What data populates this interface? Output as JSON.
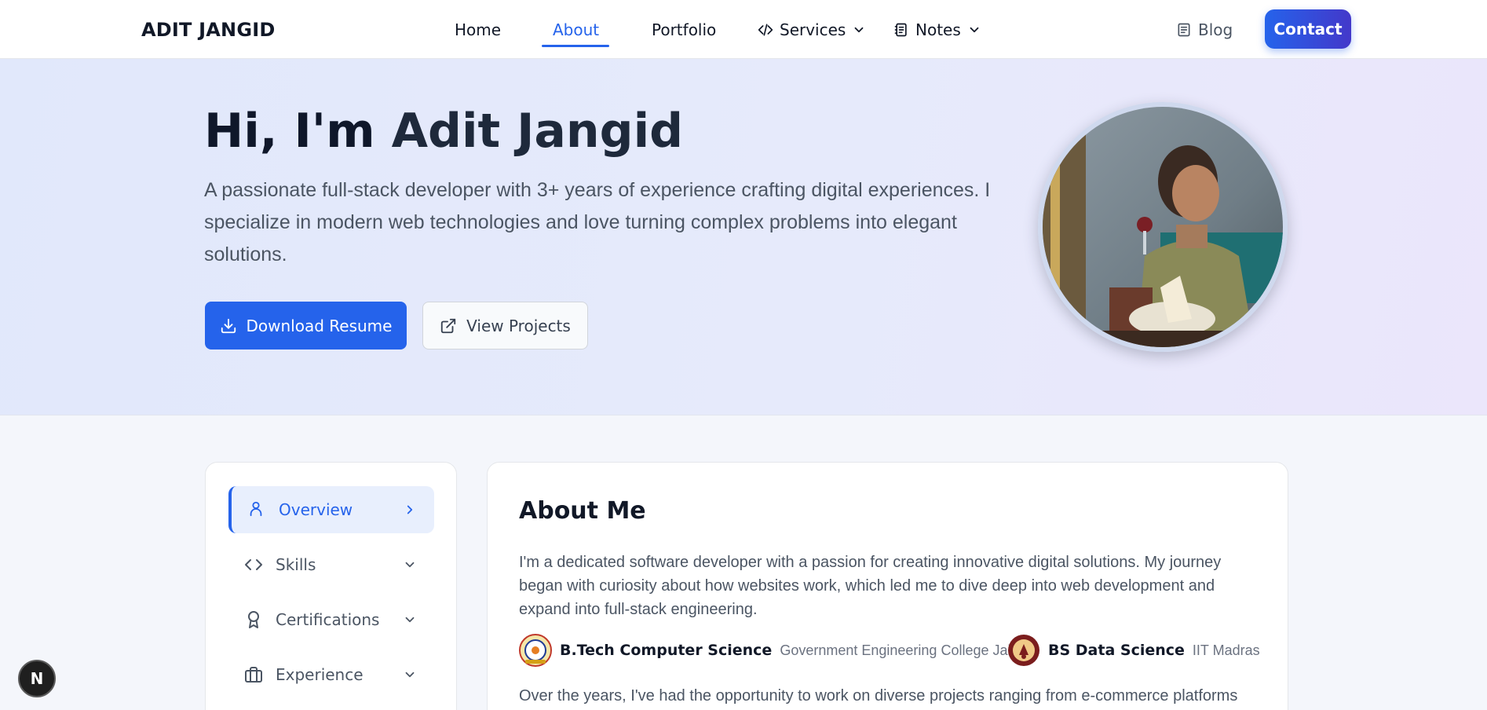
{
  "nav": {
    "brand": "ADIT JANGID",
    "home": "Home",
    "about": "About",
    "portfolio": "Portfolio",
    "services": "Services",
    "notes": "Notes",
    "blog": "Blog",
    "contact": "Contact",
    "active": "About"
  },
  "hero": {
    "greeting": "Hi, I'm",
    "name": "Adit Jangid",
    "description": "A passionate full-stack developer with 3+ years of experience crafting digital experiences. I specialize in modern web technologies and love turning complex problems into elegant solutions.",
    "download_resume": "Download Resume",
    "view_projects": "View Projects"
  },
  "sidebar": {
    "items": [
      {
        "label": "Overview",
        "icon": "user-icon",
        "active": true
      },
      {
        "label": "Skills",
        "icon": "code-icon",
        "active": false
      },
      {
        "label": "Certifications",
        "icon": "award-icon",
        "active": false
      },
      {
        "label": "Experience",
        "icon": "briefcase-icon",
        "active": false
      }
    ]
  },
  "about": {
    "title": "About Me",
    "paragraph1": "I'm a dedicated software developer with a passion for creating innovative digital solutions. My journey began with curiosity about how websites work, which led me to dive deep into web development and expand into full-stack engineering.",
    "education": [
      {
        "degree": "B.Tech Computer Science",
        "institution": "Government Engineering College Jaipur"
      },
      {
        "degree": "BS Data Science",
        "institution": "IIT Madras"
      }
    ],
    "paragraph2": "Over the years, I've had the opportunity to work on diverse projects ranging from e-commerce platforms"
  },
  "badge": {
    "letter": "N"
  },
  "colors": {
    "accent": "#2563eb",
    "contact_gradient_end": "#4338ca",
    "text_dark": "#111827",
    "text_muted": "#4b5563"
  }
}
